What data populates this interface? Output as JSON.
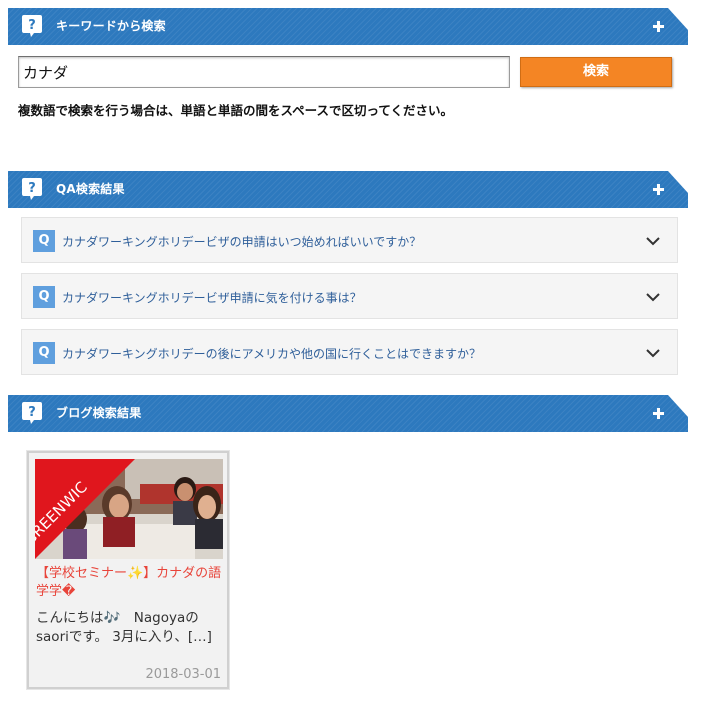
{
  "keyword_section": {
    "title": "キーワードから検索"
  },
  "search": {
    "value": "カナダ",
    "button_label": "検索",
    "hint": "複数語で検索を行う場合は、単語と単語の間をスペースで区切ってください。"
  },
  "qa_section": {
    "title": "QA検索結果",
    "items": [
      {
        "badge": "Q",
        "question": "カナダワーキングホリデービザの申請はいつ始めればいいですか？"
      },
      {
        "badge": "Q",
        "question": "カナダワーキングホリデービザ申請に気を付ける事は？"
      },
      {
        "badge": "Q",
        "question": "カナダワーキングホリデーの後にアメリカや他の国に行くことはできますか？"
      }
    ]
  },
  "blog_section": {
    "title": "ブログ検索結果",
    "posts": [
      {
        "ribbon": "GREENWIC",
        "title": "【学校セミナー✨】カナダの語学学�",
        "excerpt": "こんにちは🎶　Nagoyaのsaoriです。 3月に入り、[…]",
        "date": "2018-03-01"
      }
    ]
  },
  "colors": {
    "header_blue": "#2d79be",
    "search_button": "#f48524",
    "q_badge": "#5f9fde",
    "blog_title": "#e8443a"
  },
  "icons": {
    "section_icon": "question-speech-bubble-icon",
    "expand_icon": "plus-icon",
    "accordion_icon": "chevron-down-icon"
  }
}
